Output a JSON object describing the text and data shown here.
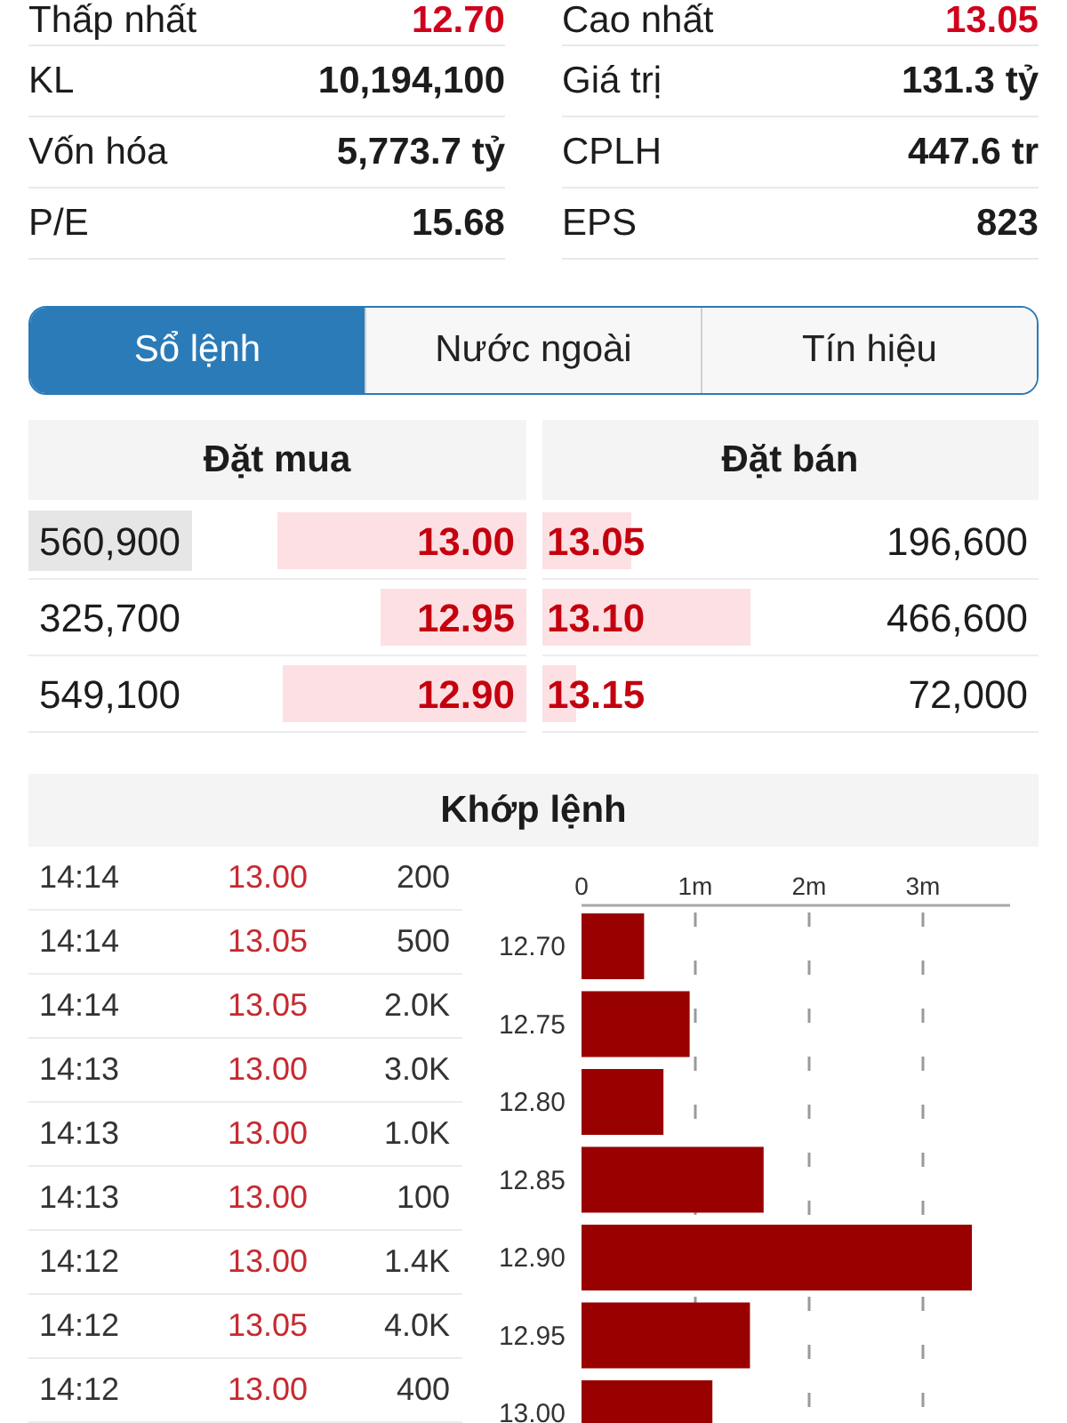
{
  "stats": [
    {
      "label": "Thấp nhất",
      "value": "12.70",
      "color": "#d0021b"
    },
    {
      "label": "Cao nhất",
      "value": "13.05",
      "color": "#d0021b"
    },
    {
      "label": "KL",
      "value": "10,194,100",
      "color": "#1c1c1c"
    },
    {
      "label": "Giá trị",
      "value": "131.3 tỷ",
      "color": "#1c1c1c"
    },
    {
      "label": "Vốn hóa",
      "value": "5,773.7 tỷ",
      "color": "#1c1c1c"
    },
    {
      "label": "CPLH",
      "value": "447.6 tr",
      "color": "#1c1c1c"
    },
    {
      "label": "P/E",
      "value": "15.68",
      "color": "#1c1c1c"
    },
    {
      "label": "EPS",
      "value": "823",
      "color": "#1c1c1c"
    }
  ],
  "tabs": [
    {
      "label": "Sổ lệnh",
      "selected": true
    },
    {
      "label": "Nước ngoài",
      "selected": false
    },
    {
      "label": "Tín hiệu",
      "selected": false
    }
  ],
  "order_book": {
    "bid_title": "Đặt mua",
    "ask_title": "Đặt bán",
    "rows": [
      {
        "bid": {
          "volume": "560,900",
          "price": "13.00",
          "level": 0.5,
          "highlighted": true
        },
        "ask": {
          "price": "13.05",
          "level": 0.18,
          "volume": "196,600",
          "highlighted": false
        }
      },
      {
        "bid": {
          "volume": "325,700",
          "price": "12.95",
          "level": 0.29,
          "highlighted": false
        },
        "ask": {
          "price": "13.10",
          "level": 0.42,
          "volume": "466,600",
          "highlighted": false
        }
      },
      {
        "bid": {
          "volume": "549,100",
          "price": "12.90",
          "level": 0.49,
          "highlighted": false
        },
        "ask": {
          "price": "13.15",
          "level": 0.07,
          "volume": "72,000",
          "highlighted": false
        }
      }
    ]
  },
  "trades": {
    "title": "Khớp lệnh",
    "rows": [
      {
        "time": "14:14",
        "price": "13.00",
        "volume": "200"
      },
      {
        "time": "14:14",
        "price": "13.05",
        "volume": "500"
      },
      {
        "time": "14:14",
        "price": "13.05",
        "volume": "2.0K"
      },
      {
        "time": "14:13",
        "price": "13.00",
        "volume": "3.0K"
      },
      {
        "time": "14:13",
        "price": "13.00",
        "volume": "1.0K"
      },
      {
        "time": "14:13",
        "price": "13.00",
        "volume": "100"
      },
      {
        "time": "14:12",
        "price": "13.00",
        "volume": "1.4K"
      },
      {
        "time": "14:12",
        "price": "13.05",
        "volume": "4.0K"
      },
      {
        "time": "14:12",
        "price": "13.00",
        "volume": "400"
      }
    ],
    "chart_data": {
      "type": "bar",
      "orientation": "horizontal",
      "categories": [
        "12.70",
        "12.75",
        "12.80",
        "12.85",
        "12.90",
        "12.95",
        "13.00"
      ],
      "values": [
        0.55,
        0.95,
        0.72,
        1.6,
        3.43,
        1.48,
        1.15
      ],
      "xlim": [
        0,
        3.75
      ],
      "xticks": [
        {
          "value": 0,
          "label": "0"
        },
        {
          "value": 1,
          "label": "1m"
        },
        {
          "value": 2,
          "label": "2m"
        },
        {
          "value": 3,
          "label": "3m"
        }
      ],
      "grid": true
    }
  }
}
